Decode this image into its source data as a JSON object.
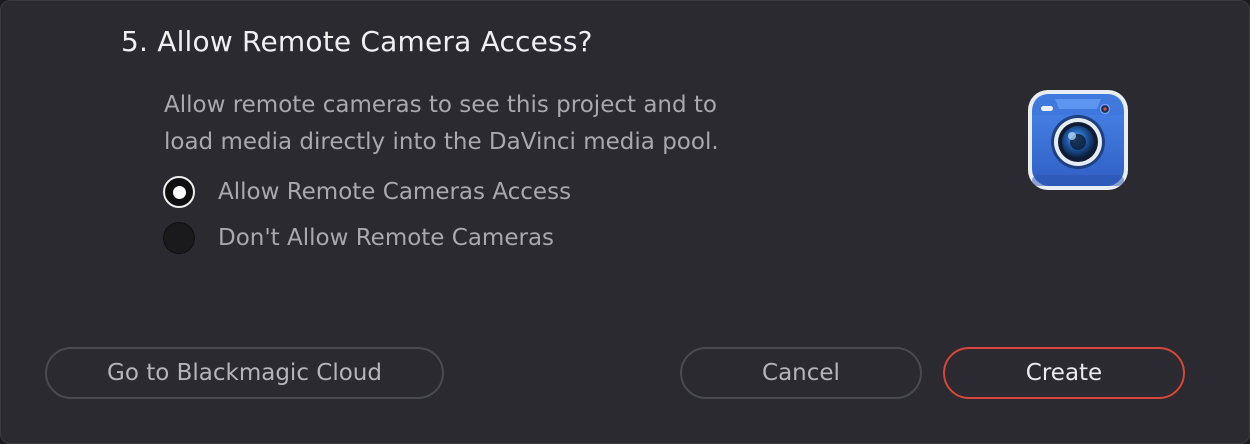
{
  "dialog": {
    "title": "5. Allow Remote Camera Access?",
    "description_line1": "Allow remote cameras to see this project and to",
    "description_line2": "load media directly into the DaVinci media pool.",
    "options": [
      {
        "label": "Allow Remote Cameras Access",
        "selected": true
      },
      {
        "label": "Don't Allow Remote Cameras",
        "selected": false
      }
    ],
    "icon": "blackmagic-camera-app-icon"
  },
  "buttons": {
    "cloud_label": "Go to Blackmagic Cloud",
    "cancel_label": "Cancel",
    "create_label": "Create"
  },
  "colors": {
    "background": "#2a2a30",
    "primary_border": "#d6473a",
    "icon_blue": "#3b6fd0"
  }
}
